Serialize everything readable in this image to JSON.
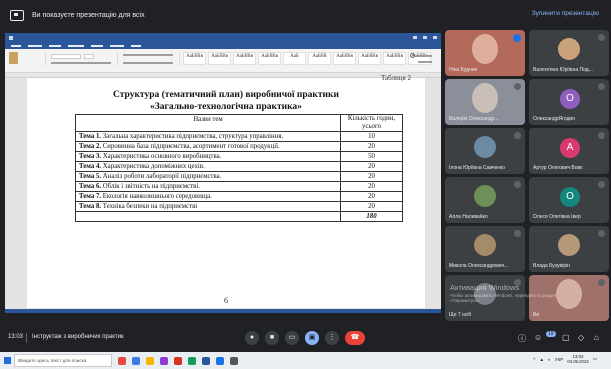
{
  "banner": {
    "text": "Ви показуєте презентацію для всіх",
    "stop_label": "Зупинити презентацію"
  },
  "doc": {
    "page_corner": "Таблиця 2",
    "title_line1": "Структура (тематичний план) виробничої практики",
    "title_line2": "«Загально-технологічна практика»",
    "col_topic": "Назви тем",
    "col_hours": "Кількість годин, усього",
    "rows": [
      {
        "topic_label": "Тема 1.",
        "topic_text": " Загальна характеристика підприємства, структура управління.",
        "hours": "10"
      },
      {
        "topic_label": "Тема 2.",
        "topic_text": " Сировинна база підприємства, асортимент готової продукції.",
        "hours": "20"
      },
      {
        "topic_label": "Тема 3.",
        "topic_text": " Характеристика основного виробництва.",
        "hours": "50"
      },
      {
        "topic_label": "Тема 4.",
        "topic_text": " Характеристика допоміжних цехів.",
        "hours": "20"
      },
      {
        "topic_label": "Тема 5.",
        "topic_text": " Аналіз роботи лабораторії підприємства.",
        "hours": "20"
      },
      {
        "topic_label": "Тема 6.",
        "topic_text": " Облік і звітність на підприємстві.",
        "hours": "20"
      },
      {
        "topic_label": "Тема 7.",
        "topic_text": " Екологія навколишнього середовища.",
        "hours": "20"
      },
      {
        "topic_label": "Тема 8.",
        "topic_text": " Техніка безпеки на підприємстві",
        "hours": "20"
      }
    ],
    "total": "180",
    "page_number": "6",
    "ribbon_styles": [
      "АаБбВв",
      "АаБбВв",
      "АаБбВв",
      "АаБбВв",
      "АаБ",
      "АаБбВ",
      "АаБбВв",
      "АаБбВв",
      "АаБбВв",
      "АаБбВв"
    ]
  },
  "participants": [
    {
      "name": "Ніна Будник",
      "initial": "",
      "color": "#b46a5a",
      "video": true
    },
    {
      "name": "Валентина Юріївна Под...",
      "initial": "",
      "color": "#c9a27a",
      "video": false
    },
    {
      "name": "Валерія Олександр...",
      "initial": "",
      "color": "#8a8f99",
      "video": true
    },
    {
      "name": "ОлександрЯгодин",
      "initial": "О",
      "color": "#8e5fbf",
      "video": false
    },
    {
      "name": "Ілона Юріївна Савченко",
      "initial": "",
      "color": "#6b8ba4",
      "video": false
    },
    {
      "name": "Артур Олегович Вовк",
      "initial": "А",
      "color": "#d93a6e",
      "video": false
    },
    {
      "name": "Алла Наливайко",
      "initial": "",
      "color": "#6f8f5a",
      "video": false
    },
    {
      "name": "Олеся Олегівна Івер",
      "initial": "О",
      "color": "#14877e",
      "video": false
    },
    {
      "name": "Микола Олександрович...",
      "initial": "",
      "color": "#a48b6a",
      "video": false
    },
    {
      "name": "Влада Бузувірін",
      "initial": "",
      "color": "#b59a7a",
      "video": false
    },
    {
      "name": "Ще 7 осіб",
      "initial": "",
      "color": "#7a7f88",
      "video": false
    },
    {
      "name": "Ви",
      "initial": "",
      "color": "#a0706a",
      "video": true
    }
  ],
  "bottom": {
    "time": "13:03",
    "meeting_title": "Інструктаж з виробничих практик",
    "mic_icon": "mic-icon",
    "camera_icon": "camera-icon",
    "captions_icon": "captions-icon",
    "reaction_icon": "reaction-icon",
    "present_icon": "present-icon",
    "more_icon": "more-icon",
    "end_icon": "end-call-icon",
    "info_icon": "info-icon",
    "people_count": "19",
    "chat_icon": "chat-icon",
    "activities_icon": "activities-icon"
  },
  "activate": {
    "line1": "Активация Windows",
    "line2": "Чтобы активировать Windows, перейдите в раздел «Параметры»."
  },
  "taskbar": {
    "search_placeholder": "Введите здесь текст для поиска",
    "lang": "УКР",
    "time": "13:03",
    "date": "03.06.2022"
  }
}
